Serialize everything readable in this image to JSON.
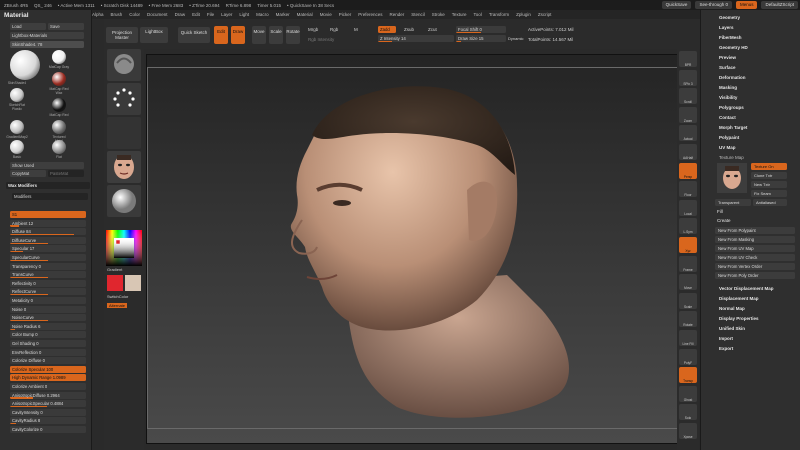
{
  "topbar": {
    "items": [
      "ZBrush 4R5",
      "QS_ 246",
      "• Active Mem 1311",
      "• Scratch Disk 14489",
      "• Free Mem 2683",
      "• ZTime 20.694",
      "RTime 6.898",
      "Timer 5.015",
      "• QuickSave In 38 Secs"
    ],
    "menu_label": "Menus",
    "quicksave": "QuickSave",
    "see_through": "See-through 0",
    "menus": "Menus",
    "script": "DefaultZScript"
  },
  "menus": [
    "Alpha",
    "Brush",
    "Color",
    "Document",
    "Draw",
    "Edit",
    "File",
    "Layer",
    "Light",
    "Macro",
    "Marker",
    "Material",
    "Movie",
    "Picker",
    "Preferences",
    "Render",
    "Stencil",
    "Stroke",
    "Texture",
    "Tool",
    "Transform",
    "Zplugin",
    "Zscript"
  ],
  "left": {
    "title": "Material",
    "load": "Load",
    "save": "Save",
    "lightbox_materials": "Lightbox›Materials",
    "current_material": "SkinShade4. 78",
    "materials": [
      {
        "label": "SkinShade4",
        "color": "#d8d8d8"
      },
      {
        "label": "MatCap Gray",
        "color": "#f0f0f0"
      },
      {
        "label": "MatCap Red Wax",
        "color": "#9a2a1f"
      },
      {
        "label": "SketchFlat Plastic",
        "color": "#c8c8c8"
      },
      {
        "label": "MatCap Red",
        "color": "#111111"
      },
      {
        "label": "GradientMap2",
        "color": "#bdbdbd"
      },
      {
        "label": "Textured Metal",
        "color": "#707070"
      },
      {
        "label": "Basic",
        "color": "#d0d0d0"
      },
      {
        "label": "Flat",
        "color": "#8c8c8c"
      },
      {
        "label": "FastShader",
        "color": "#e6e6e6"
      }
    ],
    "show_used": "Show Used",
    "copy_mat": "CopyMat",
    "paste_mat": "PasteMat",
    "wax_modifiers": "Wax Modifiers",
    "modifiers": "Modifiers",
    "sliders": [
      {
        "label": "S1",
        "value": 0.08,
        "hl": true
      },
      {
        "label": "Ambient 12",
        "value": 0.12
      },
      {
        "label": "Diffuse 84",
        "value": 0.84
      },
      {
        "label": "DiffuseCurve",
        "value": 0.5
      },
      {
        "label": "Specular 17",
        "value": 0.17
      },
      {
        "label": "SpecularCurve",
        "value": 0.5
      },
      {
        "label": "Transparency 0",
        "value": 0.0
      },
      {
        "label": "TransCurve",
        "value": 0.5
      },
      {
        "label": "Reflectivity 0",
        "value": 0.0
      },
      {
        "label": "ReflectCurve",
        "value": 0.5
      },
      {
        "label": "Metalicity 0",
        "value": 0.0
      },
      {
        "label": "Noise 0",
        "value": 0.0
      },
      {
        "label": "NoiseCurve",
        "value": 0.5
      },
      {
        "label": "Noise Radius 6",
        "value": 0.06
      },
      {
        "label": "Color Bump 0",
        "value": 0.0
      },
      {
        "label": "Gel Shading 0",
        "value": 0.0
      },
      {
        "label": "EnvReflection 0",
        "value": 0.0
      },
      {
        "label": "Colorize Diffuse 0",
        "value": 0.0
      },
      {
        "label": "Colorize Specular 100",
        "value": 1.0,
        "hl": true
      },
      {
        "label": "High Dynamic Range 1.0989",
        "value": 0.5,
        "hl": true
      },
      {
        "label": "Colorize Ambient 0",
        "value": 0.0
      },
      {
        "label": "AnisotropicDiffuse 0.2964",
        "value": 0.3
      },
      {
        "label": "AnisotropicSpecular 0.4884",
        "value": 0.49
      },
      {
        "label": "CavityIntensity 0",
        "value": 0.0
      },
      {
        "label": "CavityRadius 8",
        "value": 0.08
      },
      {
        "label": "CavityColorize 0",
        "value": 0.0
      }
    ]
  },
  "toolbar": {
    "projection_master": "Projection Master",
    "lightbox": "LightBox",
    "quick_sketch": "Quick Sketch",
    "edit": "Edit",
    "draw": "Draw",
    "move": "Move",
    "scale": "Scale",
    "rotate": "Rotate",
    "mrgb": "Mrgb",
    "rgb": "Rgb",
    "m": "M",
    "zadd": "Zadd",
    "zsub": "Zsub",
    "zcut": "Zcut",
    "rgb_intensity": "Rgb Intensity",
    "z_intensity": "Z Intensity 14",
    "focal_shift": "Focal Shift 0",
    "draw_size": "Draw Size 15",
    "dynamic": "Dynamic",
    "active_points": "ActivePoints: 7.012 Mil",
    "total_points": "TotalPoints: 14.567 Mil"
  },
  "shelf": {
    "gradient": "Gradient",
    "switch_color": "SwitchColor",
    "alternate": "Alternate",
    "main_color": "#e0262e",
    "secondary_color": "#d8c6b4"
  },
  "rshelf": [
    "BPR",
    "SPix 3",
    "Scroll",
    "Zoom",
    "Actual",
    "AAHalf",
    "Persp",
    "Floor",
    "Local",
    "L.Sym",
    "Xyz",
    "Frame",
    "Move",
    "Scale",
    "Rotate",
    "Line Fill",
    "PolyF",
    "Transp",
    "Ghost",
    "Solo",
    "Xpose"
  ],
  "right": {
    "items_top": [
      "Geometry",
      "Layers",
      "FiberMesh",
      "Geometry HD",
      "Preview",
      "Surface",
      "Deformation",
      "Masking",
      "Visibility",
      "Polygroups",
      "Contact",
      "Morph Target",
      "Polypaint",
      "UV Map"
    ],
    "texture_map": "Texture Map",
    "texture_on": "Texture On",
    "clone_txtr": "Clone Txtr",
    "new_txtr": "New Txtr",
    "fix_seam": "Fix Seam",
    "transparent": "Transparent",
    "antialiased": "Antialiased",
    "fill": "Fill",
    "create": "Create",
    "create_items": [
      "New From Polypaint",
      "New From Masking",
      "New From UV Map",
      "New From UV Check",
      "New From Vertex Order",
      "New From Poly Order"
    ],
    "items_bottom": [
      "Vector Displacement Map",
      "Displacement Map",
      "Normal Map",
      "Display Properties",
      "Unified Skin",
      "Import",
      "Export"
    ]
  },
  "colors": {
    "accent": "#d9661d",
    "panel": "#2f2f2f",
    "canvas_top": "#242424",
    "canvas_bottom": "#4a4a4a"
  }
}
